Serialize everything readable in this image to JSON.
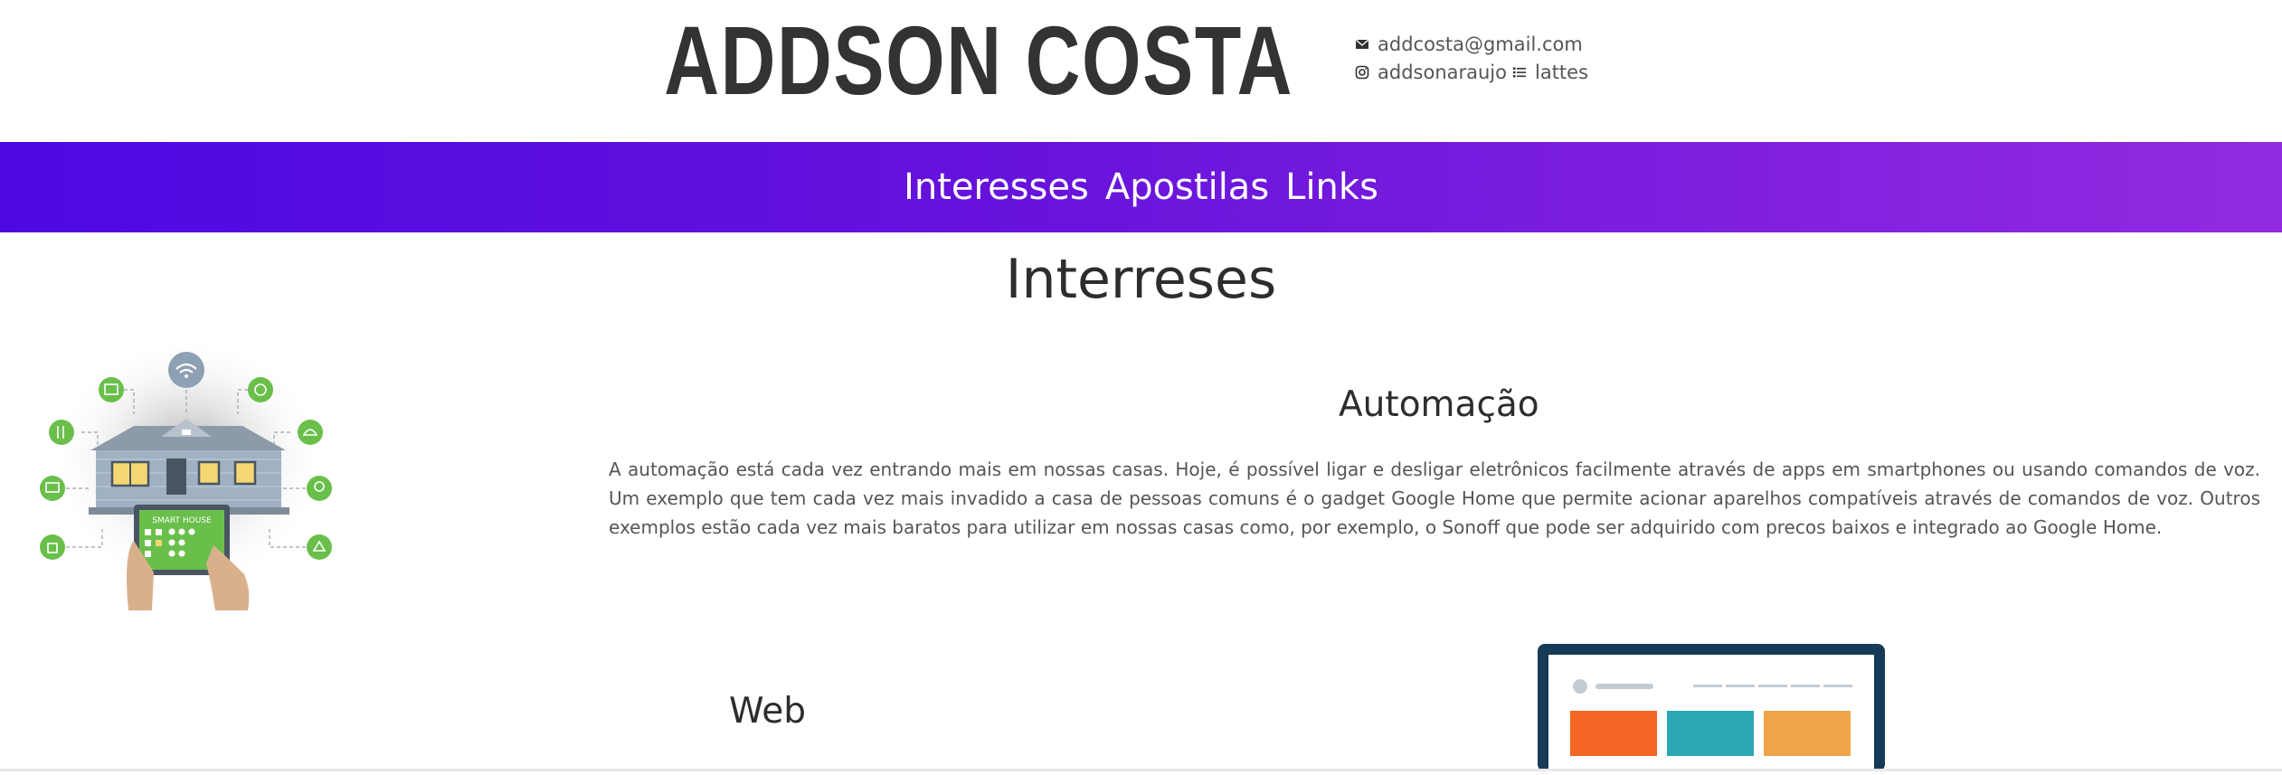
{
  "header": {
    "brand": "ADDSON COSTA",
    "email": "addcosta@gmail.com",
    "instagram": "addsonaraujo",
    "lattes": "lattes"
  },
  "nav": {
    "items": [
      "Interesses",
      "Apostilas",
      "Links"
    ]
  },
  "main": {
    "title": "Interreses",
    "automacao": {
      "title": "Automação",
      "text": "A automação está cada vez entrando mais em nossas casas. Hoje, é possível ligar e desligar eletrônicos facilmente através de apps em smartphones ou usando comandos de voz. Um exemplo que tem cada vez mais invadido a casa de pessoas comuns é o gadget Google Home que permite acionar aparelhos compatíveis através de comandos de voz. Outros exemplos estão cada vez mais baratos para utilizar em nossas casas como, por exemplo, o Sonoff que pode ser adquirido com precos baixos e integrado ao Google Home."
    },
    "web": {
      "title": "Web"
    },
    "illustration": {
      "tablet_label": "SMART HOUSE"
    }
  },
  "colors": {
    "nav_start": "#4d08e2",
    "nav_end": "#922ae0",
    "icon_green": "#6abf4b",
    "brand_text": "#333333"
  },
  "icons": [
    "envelope-icon",
    "instagram-icon",
    "list-icon"
  ]
}
